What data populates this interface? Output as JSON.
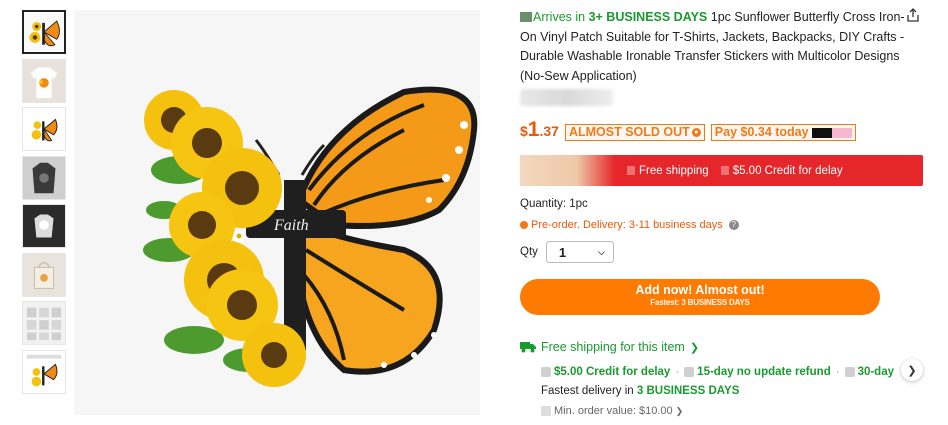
{
  "thumbnails": [
    {
      "name": "thumb-butterfly",
      "active": true
    },
    {
      "name": "thumb-shirt-model"
    },
    {
      "name": "thumb-butterfly-small"
    },
    {
      "name": "thumb-dark-shirt"
    },
    {
      "name": "thumb-white-on-dark"
    },
    {
      "name": "thumb-tote"
    },
    {
      "name": "thumb-size-chart"
    },
    {
      "name": "thumb-label-card"
    }
  ],
  "product": {
    "arrives_prefix": "Arrives in",
    "arrives_days": "3+ BUSINESS DAYS",
    "title": "1pc Sunflower Butterfly Cross Iron-On Vinyl Patch Suitable for T-Shirts, Jackets, Backpacks, DIY Crafts - Durable Washable Ironable Transfer Stickers with Multicolor Designs (No-Sew Application)"
  },
  "price": {
    "currency": "$",
    "integer": "1",
    "decimal": ".37",
    "almost_sold_out": "ALMOST SOLD OUT",
    "pay_today": "Pay $0.34 today"
  },
  "promo": {
    "free_shipping": "Free shipping",
    "credit": "$5.00 Credit for delay"
  },
  "quantity_info": "Quantity: 1pc",
  "preorder": "Pre-order. Delivery: 3-11 business days",
  "qty": {
    "label": "Qty",
    "value": "1"
  },
  "cta": {
    "label": "Add now! Almost out!",
    "sub": "Fastest: 3 BUSINESS DAYS"
  },
  "shipping": {
    "label": "Free shipping for this item",
    "benefits": [
      "$5.00 Credit for delay",
      "15-day no update refund",
      "30-day"
    ],
    "fastest_prefix": "Fastest delivery in",
    "fastest_days": "3 BUSINESS DAYS",
    "min_order": "Min. order value: $10.00"
  },
  "colors": {
    "accent_orange": "#ff7a00",
    "price_orange": "#e8590c",
    "green": "#1a9a2e",
    "promo_red": "#e5262a"
  }
}
